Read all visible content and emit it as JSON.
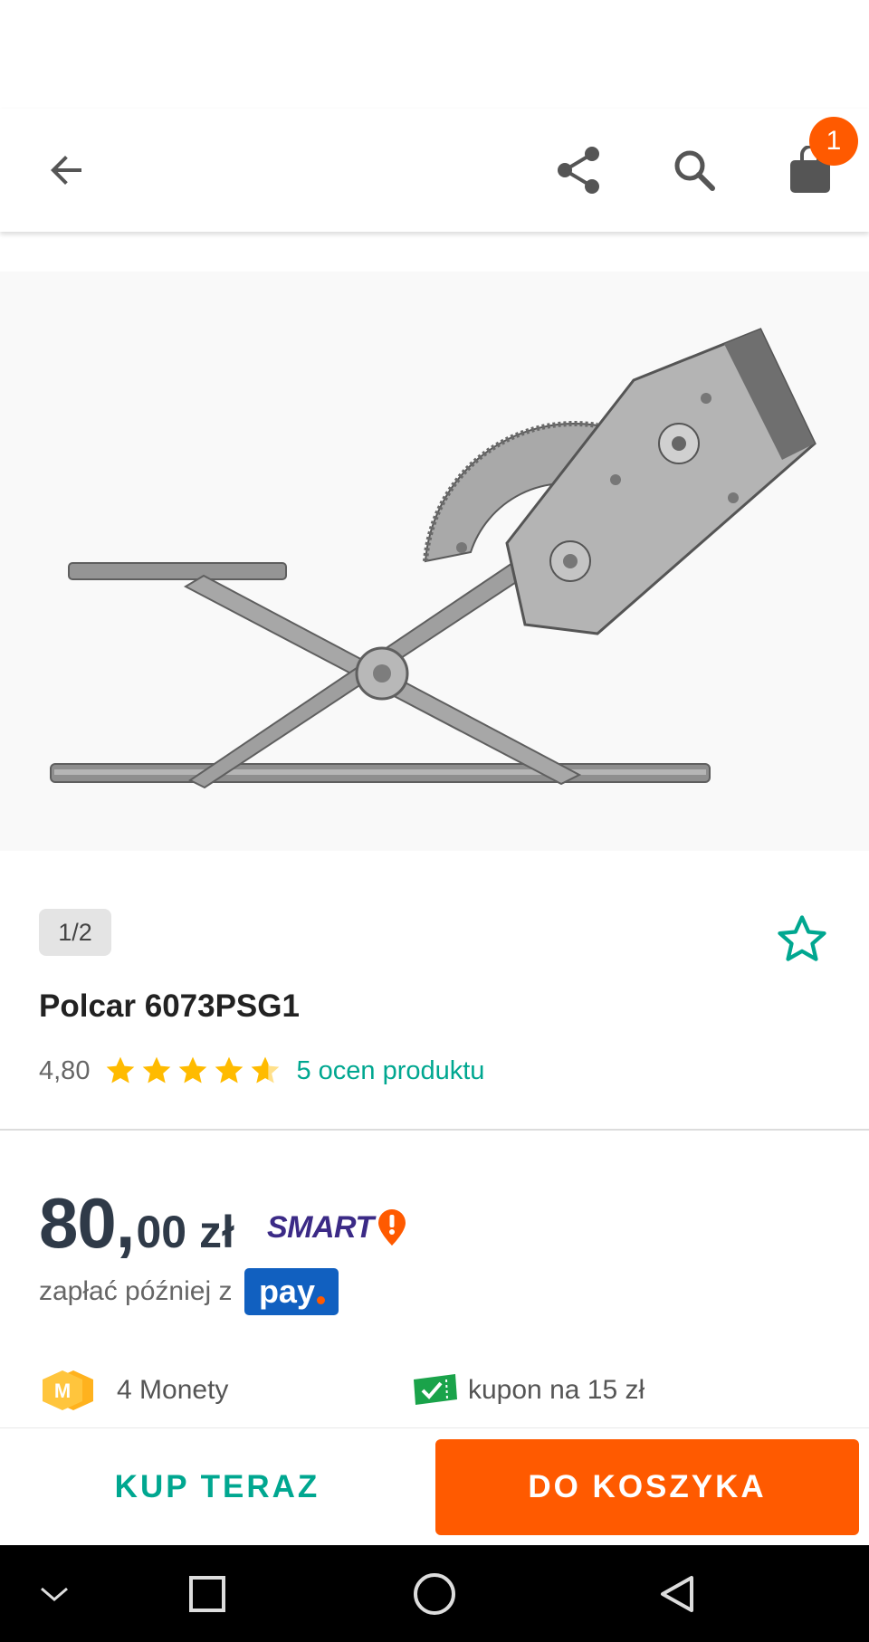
{
  "header": {
    "icons": [
      "back-arrow-icon",
      "share-icon",
      "search-icon",
      "shopping-bag-icon"
    ],
    "cart_count": "1"
  },
  "gallery": {
    "counter": "1/2",
    "image": "window-regulator-product-photo"
  },
  "product": {
    "title": "Polcar 6073PSG1",
    "rating_value": "4,80",
    "rating_stars": 4.8,
    "ratings_link": "5 ocen produktu"
  },
  "price": {
    "main": "80,",
    "rest": "00 zł",
    "smart_label": "SMART",
    "pay_later_text": "zapłać później z",
    "pay_badge": "pay"
  },
  "perks": {
    "coins": "4 Monety",
    "coupon": "kupon na 15 zł"
  },
  "actions": {
    "buy_now": "KUP TERAZ",
    "add_to_cart": "DO KOSZYKA"
  },
  "colors": {
    "accent": "#ff5a00",
    "teal": "#00a790",
    "price": "#2f3a48",
    "smart": "#3b2a86",
    "pay": "#1160c0",
    "star": "#ffbb00"
  }
}
